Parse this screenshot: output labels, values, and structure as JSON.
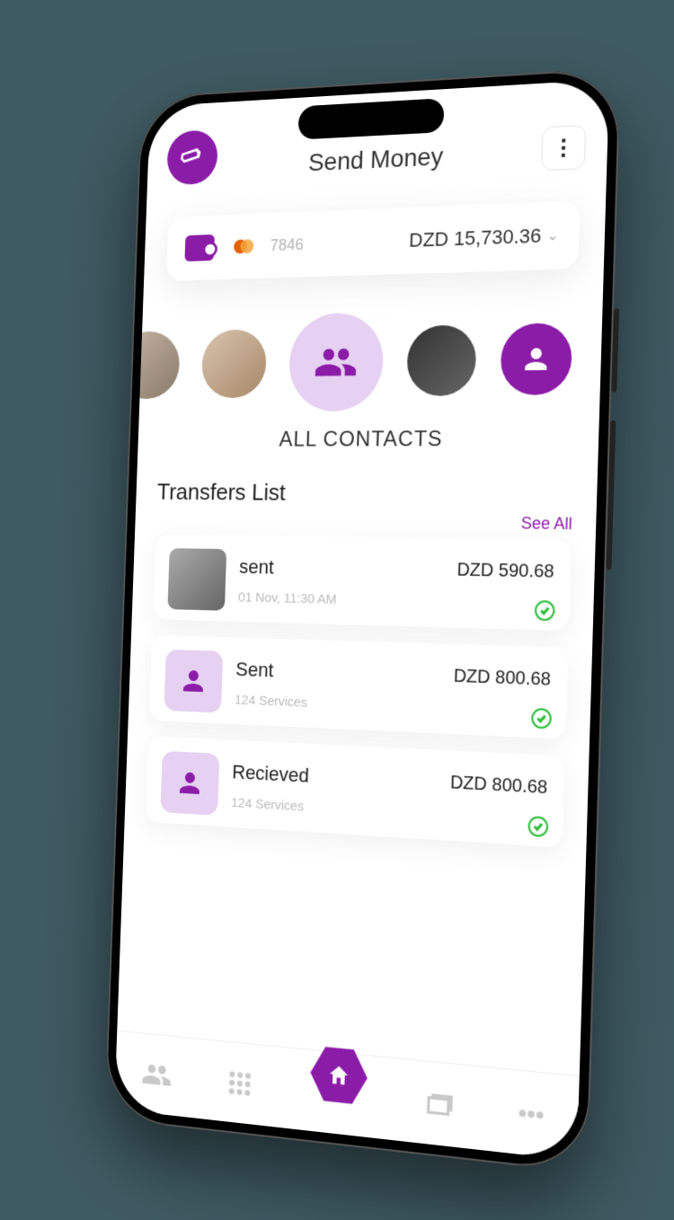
{
  "header": {
    "title": "Send Money"
  },
  "balance": {
    "card_last4": "7846",
    "currency": "DZD",
    "amount": "15,730.36"
  },
  "contacts": {
    "all_label": "ALL CONTACTS"
  },
  "transfers": {
    "title": "Transfers List",
    "see_all": "See All",
    "items": [
      {
        "label": "sent",
        "sub": "01 Nov, 11:30 AM",
        "amount": "DZD 590.68"
      },
      {
        "label": "Sent",
        "sub": "124 Services",
        "amount": "DZD 800.68"
      },
      {
        "label": "Recieved",
        "sub": "124 Services",
        "amount": "DZD 800.68"
      }
    ]
  },
  "colors": {
    "accent": "#8B1CA8",
    "accent_light": "#E6D1F2",
    "success": "#2DBE3B"
  }
}
